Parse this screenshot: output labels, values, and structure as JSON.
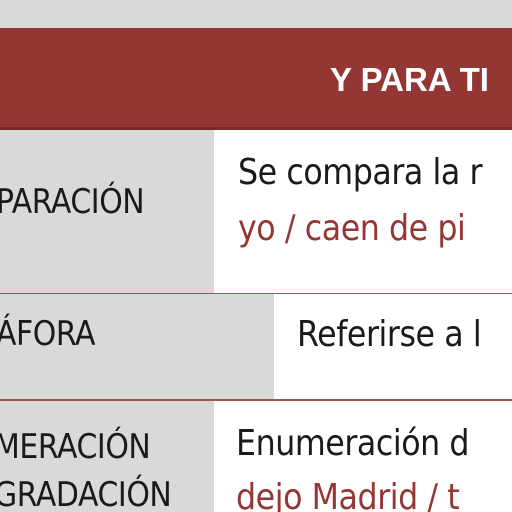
{
  "header": {
    "title": "Y PARA TI"
  },
  "rows": [
    {
      "term": "PARACIÓN",
      "definition_line1": "Se compara la r",
      "definition_line2": "yo / caen de pi"
    },
    {
      "term": "ÁFORA",
      "definition_line1": "Referirse a l"
    },
    {
      "term_line1": "MERACIÓN",
      "term_line2": "GRADACIÓN",
      "definition_line1": "Enumeración d",
      "definition_line2": "dejo Madrid / t"
    }
  ],
  "colors": {
    "header_background": "#943634",
    "example_text": "#943634",
    "term_cell": "#d9d9d9",
    "definition_cell": "#ffffff"
  }
}
